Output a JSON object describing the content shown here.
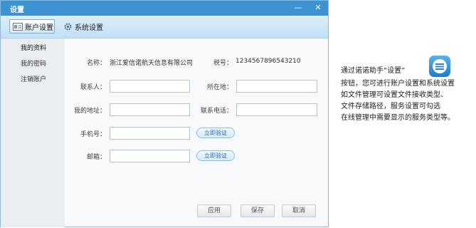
{
  "window": {
    "title": "设置",
    "minimize": "—",
    "close": "✕"
  },
  "toolbar": {
    "account_settings": "账户设置",
    "system_settings": "系统设置"
  },
  "sidebar": {
    "items": [
      {
        "label": "我的资料"
      },
      {
        "label": "我的密码"
      },
      {
        "label": "注销账户"
      }
    ]
  },
  "form": {
    "name_label": "名称：",
    "name_value": "浙江爱信诺航天信息有限公司",
    "tax_label": "税号：",
    "tax_value": "1234567896543210",
    "contact_label": "联系人：",
    "contact_value": "",
    "location_label": "所在地：",
    "location_value": "",
    "address_label": "我的地址：",
    "address_value": "",
    "phone_label": "联系电话：",
    "phone_value": "",
    "mobile_label": "手机号：",
    "mobile_value": "",
    "email_label": "邮箱：",
    "email_value": "",
    "verify_label": "立即验证"
  },
  "buttons": {
    "apply": "应用",
    "save": "保存",
    "cancel": "取消"
  },
  "note": {
    "line1": "通过诺诺助手“设置”",
    "line2": "按钮，您可进行账户设置和系统设置",
    "line3": "  如文件管理可设置文件接收类型、",
    "line4": "文件存储路径，服务设置可勾选",
    "line5": "在线管理中需要显示的服务类型等。"
  },
  "icons": {
    "settings_app": "settings-app-icon",
    "account": "account-card-icon",
    "system": "gear-icon"
  },
  "colors": {
    "titlebar": "#3d93d2",
    "toolbar": "#c2e0f6",
    "sidebar": "#eaeef1"
  }
}
